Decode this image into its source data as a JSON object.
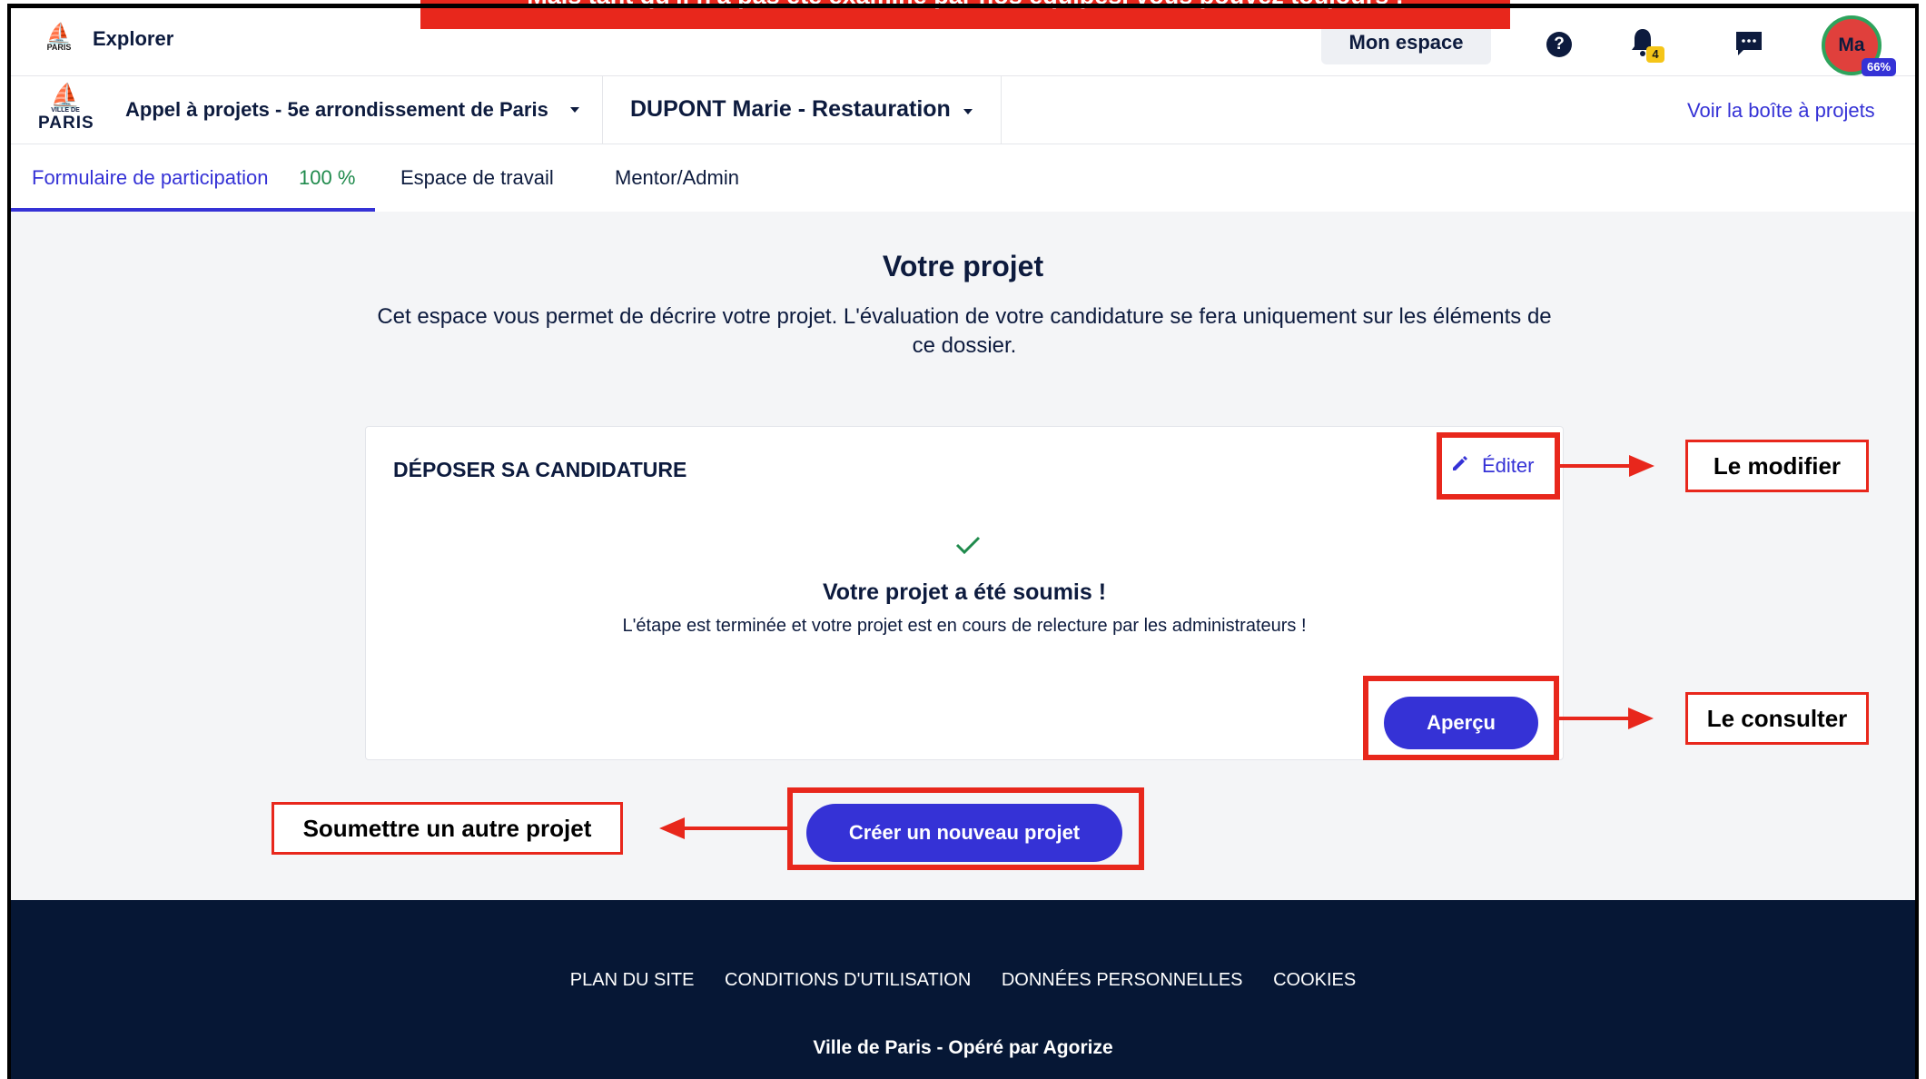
{
  "banner": {
    "text": "Mais tant qu'il n'a pas été examiné par nos équipes, vous pouvez toujours :"
  },
  "topbar": {
    "logo_text": "PARIS",
    "explorer_label": "Explorer",
    "mon_espace_label": "Mon espace",
    "help_label": "?",
    "notification_count": "4",
    "avatar_initials": "Ma",
    "avatar_progress": "66%"
  },
  "subbar": {
    "logo_small": "VILLE DE",
    "logo_big": "PARIS",
    "appel_label": "Appel à projets - 5e arrondissement de Paris",
    "project_label": "DUPONT Marie - Restauration",
    "voir_label": "Voir la boîte à projets"
  },
  "tabs": {
    "formulaire": "Formulaire de participation",
    "formulaire_pct": "100 %",
    "espace": "Espace de travail",
    "mentor": "Mentor/Admin"
  },
  "main": {
    "title": "Votre projet",
    "intro": "Cet espace vous permet de décrire votre projet. L'évaluation de votre candidature se fera uniquement sur les éléments de ce dossier.",
    "card": {
      "title": "DÉPOSER SA CANDIDATURE",
      "edit_label": "Éditer",
      "submitted_title": "Votre projet a été soumis !",
      "submitted_text": "L'étape est terminée et votre projet est en cours de relecture par les administrateurs !",
      "preview_label": "Aperçu"
    },
    "create_label": "Créer un nouveau projet"
  },
  "annotations": {
    "modify": "Le modifier",
    "consult": "Le consulter",
    "submit_other": "Soumettre un autre projet"
  },
  "footer": {
    "links": [
      "PLAN DU SITE",
      "CONDITIONS D'UTILISATION",
      "DONNÉES PERSONNELLES",
      "COOKIES"
    ],
    "credit": "Ville de Paris - Opéré par Agorize"
  },
  "colors": {
    "accent": "#3532d6",
    "annotation_red": "#e8271c",
    "footer_bg": "#061735",
    "success_green": "#1f8a4c"
  }
}
